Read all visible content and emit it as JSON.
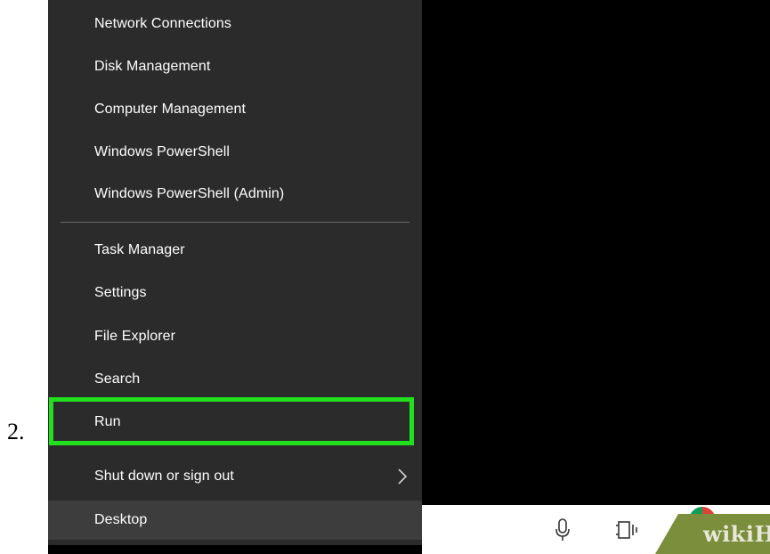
{
  "step_number": "2.",
  "menu": {
    "groups": [
      [
        "Network Connections",
        "Disk Management",
        "Computer Management",
        "Windows PowerShell",
        "Windows PowerShell (Admin)"
      ],
      [
        "Task Manager",
        "Settings",
        "File Explorer",
        "Search",
        "Run"
      ]
    ],
    "shutdown": "Shut down or sign out",
    "desktop": "Desktop",
    "highlighted_item": "Run",
    "highlight_color": "#22e01e",
    "background_color": "#2b2b2b"
  },
  "taskbar": {
    "icons": [
      "microphone-icon",
      "task-view-icon",
      "chrome-icon",
      "folder-icon"
    ]
  },
  "watermark": "wikiHow"
}
